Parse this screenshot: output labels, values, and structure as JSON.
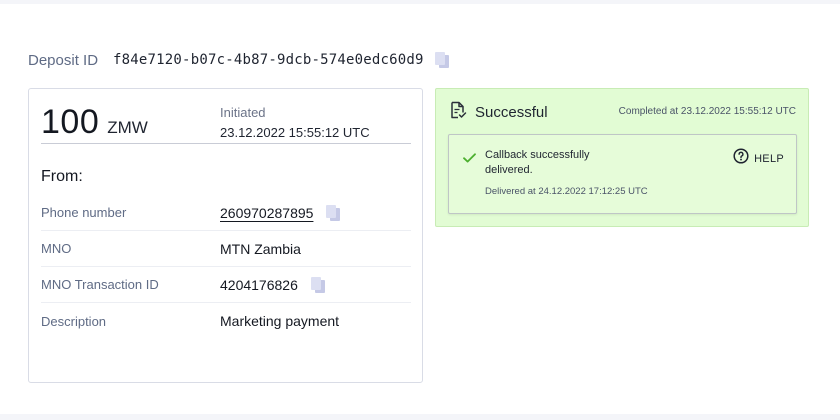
{
  "deposit": {
    "label": "Deposit ID",
    "id": "f84e7120-b07c-4b87-9dcb-574e0edc60d9"
  },
  "amount": {
    "value": "100",
    "currency": "ZMW",
    "status_label": "Initiated",
    "status_time": "23.12.2022 15:55:12 UTC"
  },
  "from": {
    "title": "From:",
    "rows": [
      {
        "label": "Phone number",
        "value": "260970287895"
      },
      {
        "label": "MNO",
        "value": "MTN Zambia"
      },
      {
        "label": "MNO Transaction ID",
        "value": "4204176826"
      },
      {
        "label": "Description",
        "value": "Marketing payment"
      }
    ]
  },
  "status_panel": {
    "title": "Successful",
    "completed": "Completed at 23.12.2022 15:55:12 UTC",
    "callback_message": "Callback successfully delivered.",
    "delivered": "Delivered at 24.12.2022 17:12:25 UTC",
    "help_label": "HELP"
  },
  "colors": {
    "success_bg": "#e2fcd4",
    "check_green": "#4caf2e",
    "copy_icon": "#c5c9e6"
  },
  "icons": [
    "copy-icon",
    "document-check-icon",
    "check-icon",
    "help-icon"
  ]
}
